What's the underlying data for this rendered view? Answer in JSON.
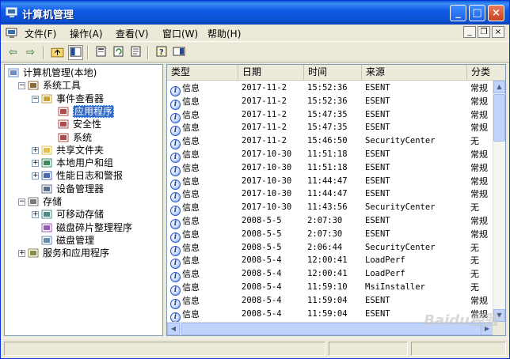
{
  "window": {
    "title": "计算机管理",
    "controls": {
      "minimize": "_",
      "maximize": "□",
      "close": "×"
    }
  },
  "menu": {
    "items": [
      "文件(F)",
      "操作(A)",
      "查看(V)",
      "窗口(W)",
      "帮助(H)"
    ],
    "mdi": {
      "minimize": "_",
      "restore": "❐",
      "close": "×"
    }
  },
  "toolbar": {
    "icons": [
      "back-icon",
      "forward-icon",
      "up-folder-icon",
      "show-hide-tree-icon",
      "properties-icon",
      "refresh-icon",
      "export-list-icon",
      "help-icon",
      "show-pane-icon"
    ]
  },
  "tree": {
    "items": [
      {
        "label": "计算机管理(本地)",
        "icon": "computer-icon",
        "level": 0,
        "expander": ""
      },
      {
        "label": "系统工具",
        "icon": "tools-icon",
        "level": 1,
        "expander": "−"
      },
      {
        "label": "事件查看器",
        "icon": "event-viewer-icon",
        "level": 2,
        "expander": "−"
      },
      {
        "label": "应用程序",
        "icon": "log-icon",
        "level": 3,
        "expander": "",
        "selected": true
      },
      {
        "label": "安全性",
        "icon": "log-icon",
        "level": 3,
        "expander": ""
      },
      {
        "label": "系统",
        "icon": "log-icon",
        "level": 3,
        "expander": ""
      },
      {
        "label": "共享文件夹",
        "icon": "shared-folder-icon",
        "level": 2,
        "expander": "+"
      },
      {
        "label": "本地用户和组",
        "icon": "users-icon",
        "level": 2,
        "expander": "+"
      },
      {
        "label": "性能日志和警报",
        "icon": "performance-icon",
        "level": 2,
        "expander": "+"
      },
      {
        "label": "设备管理器",
        "icon": "device-manager-icon",
        "level": 2,
        "expander": ""
      },
      {
        "label": "存储",
        "icon": "storage-icon",
        "level": 1,
        "expander": "−"
      },
      {
        "label": "可移动存储",
        "icon": "removable-storage-icon",
        "level": 2,
        "expander": "+"
      },
      {
        "label": "磁盘碎片整理程序",
        "icon": "defrag-icon",
        "level": 2,
        "expander": ""
      },
      {
        "label": "磁盘管理",
        "icon": "disk-management-icon",
        "level": 2,
        "expander": ""
      },
      {
        "label": "服务和应用程序",
        "icon": "services-icon",
        "level": 1,
        "expander": "+"
      }
    ]
  },
  "list": {
    "columns": [
      "类型",
      "日期",
      "时间",
      "来源",
      "分类"
    ],
    "rows": [
      [
        "信息",
        "2017-11-2",
        "15:52:36",
        "ESENT",
        "常规"
      ],
      [
        "信息",
        "2017-11-2",
        "15:52:36",
        "ESENT",
        "常规"
      ],
      [
        "信息",
        "2017-11-2",
        "15:47:35",
        "ESENT",
        "常规"
      ],
      [
        "信息",
        "2017-11-2",
        "15:47:35",
        "ESENT",
        "常规"
      ],
      [
        "信息",
        "2017-11-2",
        "15:46:50",
        "SecurityCenter",
        "无"
      ],
      [
        "信息",
        "2017-10-30",
        "11:51:18",
        "ESENT",
        "常规"
      ],
      [
        "信息",
        "2017-10-30",
        "11:51:18",
        "ESENT",
        "常规"
      ],
      [
        "信息",
        "2017-10-30",
        "11:44:47",
        "ESENT",
        "常规"
      ],
      [
        "信息",
        "2017-10-30",
        "11:44:47",
        "ESENT",
        "常规"
      ],
      [
        "信息",
        "2017-10-30",
        "11:43:56",
        "SecurityCenter",
        "无"
      ],
      [
        "信息",
        "2008-5-5",
        "2:07:30",
        "ESENT",
        "常规"
      ],
      [
        "信息",
        "2008-5-5",
        "2:07:30",
        "ESENT",
        "常规"
      ],
      [
        "信息",
        "2008-5-5",
        "2:06:44",
        "SecurityCenter",
        "无"
      ],
      [
        "信息",
        "2008-5-4",
        "12:00:41",
        "LoadPerf",
        "无"
      ],
      [
        "信息",
        "2008-5-4",
        "12:00:41",
        "LoadPerf",
        "无"
      ],
      [
        "信息",
        "2008-5-4",
        "11:59:10",
        "MsiInstaller",
        "无"
      ],
      [
        "信息",
        "2008-5-4",
        "11:59:04",
        "ESENT",
        "常规"
      ],
      [
        "信息",
        "2008-5-4",
        "11:59:04",
        "ESENT",
        "常规"
      ]
    ]
  },
  "watermark": "Baidu经验"
}
